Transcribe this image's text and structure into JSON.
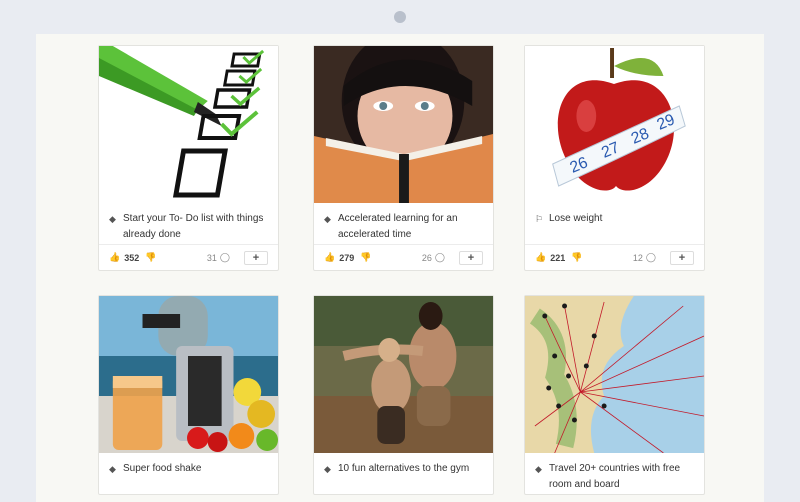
{
  "cards": [
    {
      "title": "Start your To- Do list with things already done",
      "icon": "diamond-icon",
      "likes": "352",
      "comments": "31",
      "action": "+"
    },
    {
      "title": "Accelerated learning for an accelerated time",
      "icon": "diamond-icon",
      "likes": "279",
      "comments": "26",
      "action": "+"
    },
    {
      "title": "Lose weight",
      "icon": "flag-icon",
      "likes": "221",
      "comments": "12",
      "action": "+"
    },
    {
      "title": "Super food shake",
      "icon": "diamond-icon"
    },
    {
      "title": "10 fun alternatives to the gym",
      "icon": "diamond-icon"
    },
    {
      "title": "Travel 20+ countries with free room and board",
      "icon": "diamond-icon"
    }
  ]
}
